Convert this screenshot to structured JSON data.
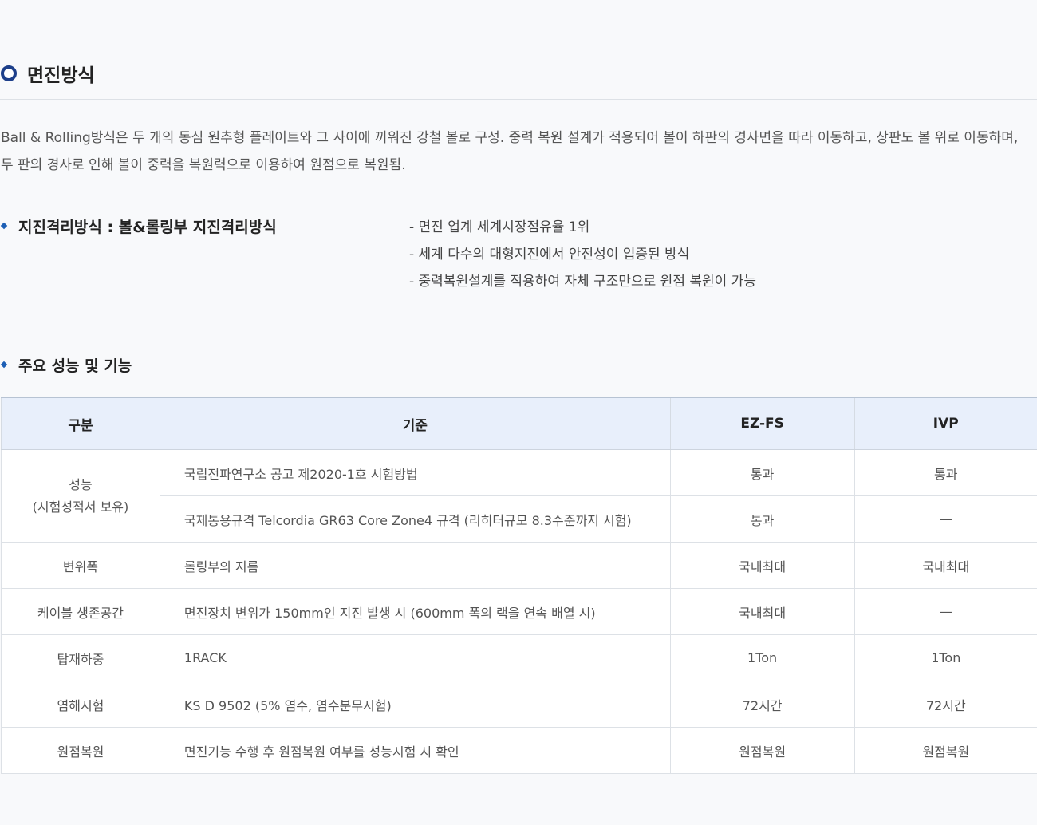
{
  "section": {
    "title": "면진방식"
  },
  "description": [
    "Ball & Rolling방식은 두 개의 동심 원추형 플레이트와 그 사이에 끼워진 강철 볼로 구성. 중력 복원 설계가 적용되어 볼이 하판의 경사면을 따라 이동하고, 상판도 볼 위로 이동하며,",
    "두 판의 경사로 인해 볼이 중력을 복원력으로 이용하여 원점으로 복원됨."
  ],
  "isolation": {
    "title": "지진격리방식 :  볼&롤링부 지진격리방식",
    "features": [
      "- 면진 업계 세계시장점유율 1위",
      "- 세계 다수의 대형지진에서 안전성이 입증된 방식",
      "- 중력복원설계를 적용하여 자체 구조만으로 원점 복원이 가능"
    ]
  },
  "performance": {
    "title": "주요 성능 및 기능",
    "headers": [
      "구분",
      "기준",
      "EZ-FS",
      "IVP"
    ],
    "category_performance": [
      "성능",
      "(시험성적서 보유)"
    ],
    "rows": [
      {
        "standard": "국립전파연구소 공고 제2020-1호 시험방법",
        "ezfs": "통과",
        "ivp": "통과"
      },
      {
        "standard": "국제통용규격 Telcordia GR63 Core Zone4 규격 (리히터규모 8.3수준까지 시험)",
        "ezfs": "통과",
        "ivp": "—"
      },
      {
        "category": "변위폭",
        "standard": "롤링부의 지름",
        "ezfs": "국내최대",
        "ivp": "국내최대"
      },
      {
        "category": "케이블 생존공간",
        "standard": "면진장치 변위가 150mm인 지진 발생 시 (600mm 폭의 랙을 연속 배열 시)",
        "ezfs": "국내최대",
        "ivp": "—"
      },
      {
        "category": "탑재하중",
        "standard": "1RACK",
        "ezfs": "1Ton",
        "ivp": "1Ton"
      },
      {
        "category": "염해시험",
        "standard": "KS D 9502 (5% 염수, 염수분무시험)",
        "ezfs": "72시간",
        "ivp": "72시간"
      },
      {
        "category": "원점복원",
        "standard": "면진기능 수행 후 원점복원 여부를 성능시험 시 확인",
        "ezfs": "원점복원",
        "ivp": "원점복원"
      }
    ]
  }
}
